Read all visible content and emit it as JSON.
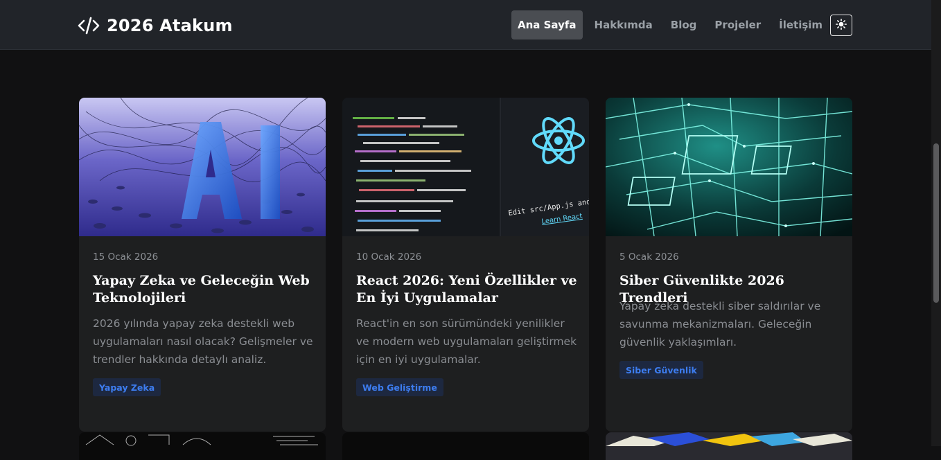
{
  "header": {
    "brand": "2026 Atakum",
    "nav": [
      "Ana Sayfa",
      "Hakkımda",
      "Blog",
      "Projeler",
      "İletişim"
    ],
    "active_nav": "Ana Sayfa",
    "brand_icon": "code-icon",
    "theme_icon": "sun-icon"
  },
  "posts": [
    {
      "date": "15 Ocak 2026",
      "title": "Yapay Zeka ve Geleceğin Web Teknolojileri",
      "description": "2026 yılında yapay zeka destekli web uygulamaları nasıl olacak? Gelişmeler ve trendler hakkında detaylı analiz.",
      "tag": "Yapay Zeka"
    },
    {
      "date": "10 Ocak 2026",
      "title": "React 2026: Yeni Özellikler ve En İyi Uygulamalar",
      "description": "React'in en son sürümündeki yenilikler ve modern web uygulamaları geliştirmek için en iyi uygulamalar.",
      "tag": "Web Geliştirme",
      "image_caption": "Edit src/App.js and save to reload.",
      "image_link": "Learn React"
    },
    {
      "date": "5 Ocak 2026",
      "title": "Siber Güvenlikte 2026 Trendleri",
      "description": "Yapay zeka destekli siber saldırılar ve savunma mekanizmaları. Geleceğin güvenlik yaklaşımları.",
      "tag": "Siber Güvenlik"
    }
  ],
  "colors": {
    "background": "#111112",
    "header": "#212429",
    "card": "#1e1f20",
    "tag_text": "#3d7df0",
    "tag_bg": "#1d2840"
  }
}
